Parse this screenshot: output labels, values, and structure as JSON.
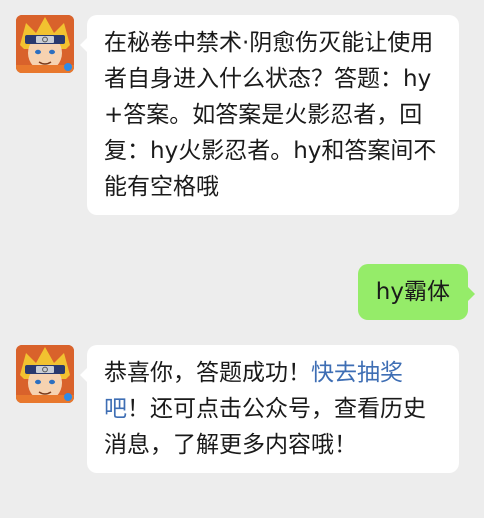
{
  "chat": {
    "messages": [
      {
        "sender": "official-account",
        "avatar_icon": "naruto-avatar-icon",
        "text": "在秘卷中禁术·阴愈伤灭能让使用者自身进入什么状态？答题：hy+答案。如答案是火影忍者，回复：hy火影忍者。hy和答案间不能有空格哦"
      },
      {
        "sender": "me",
        "text": "hy霸体"
      },
      {
        "sender": "official-account",
        "avatar_icon": "naruto-avatar-icon",
        "text_before": "恭喜你，答题成功！",
        "link_text": "快去抽奖吧",
        "text_after": "！还可点击公众号，查看历史消息，了解更多内容哦！"
      }
    ]
  },
  "colors": {
    "background": "#ededed",
    "incoming_bubble": "#ffffff",
    "outgoing_bubble": "#95ec69",
    "link": "#3e6eb4"
  }
}
